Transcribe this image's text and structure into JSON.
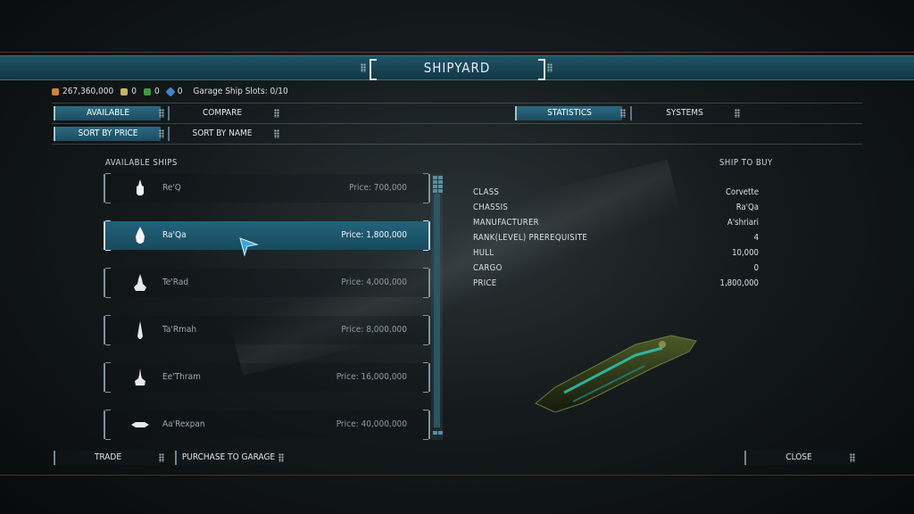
{
  "header": {
    "title": "SHIPYARD"
  },
  "resources": {
    "credits": "267,360,000",
    "res2": "0",
    "res3": "0",
    "res4": "0",
    "garage_slots": "Garage Ship Slots: 0/10"
  },
  "tabs_left": [
    {
      "label": "AVAILABLE",
      "active": true
    },
    {
      "label": "COMPARE",
      "active": false
    }
  ],
  "tabs_right": [
    {
      "label": "STATISTICS",
      "active": true
    },
    {
      "label": "SYSTEMS",
      "active": false
    }
  ],
  "sort": [
    {
      "label": "SORT BY PRICE",
      "active": true
    },
    {
      "label": "SORT BY NAME",
      "active": false
    }
  ],
  "list": {
    "title": "AVAILABLE SHIPS",
    "ships": [
      {
        "name": "Re'Q",
        "price": "Price: 700,000",
        "selected": false
      },
      {
        "name": "Ra'Qa",
        "price": "Price: 1,800,000",
        "selected": true
      },
      {
        "name": "Te'Rad",
        "price": "Price: 4,000,000",
        "selected": false
      },
      {
        "name": "Ta'Rmah",
        "price": "Price: 8,000,000",
        "selected": false
      },
      {
        "name": "Ee'Thram",
        "price": "Price: 16,000,000",
        "selected": false
      },
      {
        "name": "Aa'Rexpan",
        "price": "Price: 40,000,000",
        "selected": false
      }
    ]
  },
  "details": {
    "title": "SHIP TO BUY",
    "rows": [
      {
        "key": "CLASS",
        "value": "Corvette"
      },
      {
        "key": "CHASSIS",
        "value": "Ra'Qa"
      },
      {
        "key": "MANUFACTURER",
        "value": "A'shriari"
      },
      {
        "key": "RANK(LEVEL) PREREQUISITE",
        "value": "4"
      },
      {
        "key": "HULL",
        "value": "10,000"
      },
      {
        "key": "CARGO",
        "value": "0"
      },
      {
        "key": "PRICE",
        "value": "1,800,000"
      }
    ]
  },
  "footer": {
    "trade": "TRADE",
    "purchase": "PURCHASE TO GARAGE",
    "close": "CLOSE"
  },
  "colors": {
    "accent": "#1f5366",
    "selected": "#23637c",
    "text": "#dbe6ea"
  },
  "icons": [
    "credits-icon",
    "gear-icon",
    "crystal-icon",
    "gem-icon",
    "grid-view-icon",
    "ship-silhouette-icon",
    "cursor-arrow-icon"
  ]
}
